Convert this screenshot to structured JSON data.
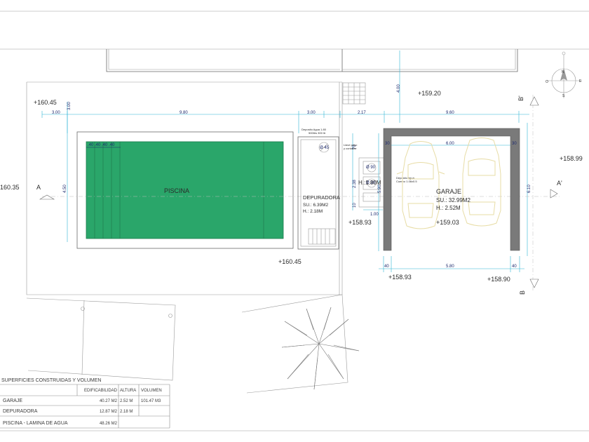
{
  "colors": {
    "pool_fill": "#2aa66a",
    "dimension_line": "#2fb5d6",
    "dimension_text": "#1d2a6e",
    "car_outline": "#e7dca5",
    "garage_wall": "#7a7a7a"
  },
  "levels": {
    "l1": "+160.45",
    "l2": "+159.20",
    "l3": "+158.99",
    "l4": "160.35",
    "l5": "+158.93",
    "l6": "+159.03",
    "l7": "+160.45",
    "l8": "+158.93",
    "l9": "+158.90"
  },
  "dimensions": {
    "top_300a": "3.00",
    "top_980": "9.80",
    "top_300b": "3.00",
    "top_217": "2.17",
    "top_960": "9.60",
    "garage_600": "6.00",
    "garage_30a": "30",
    "garage_30b": "30",
    "bottom_40a": "40",
    "bottom_580": "5.80",
    "bottom_40b": "40",
    "side_300": "3.00",
    "side_400": "4.00",
    "side_450": "4.50",
    "side_590": "5.90",
    "side_610": "6.10",
    "side_238": "2.38",
    "side_100": "1.00",
    "side_70": "70",
    "side_10": "10",
    "pool_steps": ".40 .40 .40 .40"
  },
  "rooms": {
    "pool": "PISCINA",
    "depuradora_name": "DEPURADORA",
    "depuradora_su": "SU.: 6.39M2",
    "depuradora_h": "H.: 2.18M",
    "garage_name": "GARAJE",
    "garage_su": "SU.: 32.99M2",
    "garage_h": "H.: 2.52M",
    "tank_h": "H.:1.80M"
  },
  "small_notes": {
    "deposit_top": "Deposito Agua 1.80",
    "deposit_top2": "500ltrs 300 ltr",
    "deposit_mid": "Deposito agua",
    "deposit_mid2": "Cuerpo 1.06x0.5",
    "valve": "Llave paso",
    "valve2": "y contador",
    "d45": "Ø 45",
    "d90a": "Ø 90",
    "d90b": "Ø 90"
  },
  "section_marks": {
    "a_left": "A",
    "a_right": "A'",
    "b_top": "B'",
    "b_bottom": "B"
  },
  "compass": {
    "n": "N",
    "e": "E",
    "s": "S",
    "o": "O"
  },
  "table": {
    "title": "SUPERFICIES CONSTRUIDAS Y VOLUMEN",
    "headers": [
      "EDIFICABILIDAD",
      "ALTURA",
      "VOLUMEN"
    ],
    "rows": [
      {
        "name": "GARAJE",
        "edif": "40.27 M2",
        "altura": "2.52 M",
        "volumen": "101.47 M3"
      },
      {
        "name": "DEPURADORA",
        "edif": "12.87 M2",
        "altura": "2.18 M",
        "volumen": ""
      },
      {
        "name": "PISCINA - LAMINA DE AGUA",
        "edif": "48.26 M2",
        "altura": "",
        "volumen": ""
      }
    ]
  }
}
